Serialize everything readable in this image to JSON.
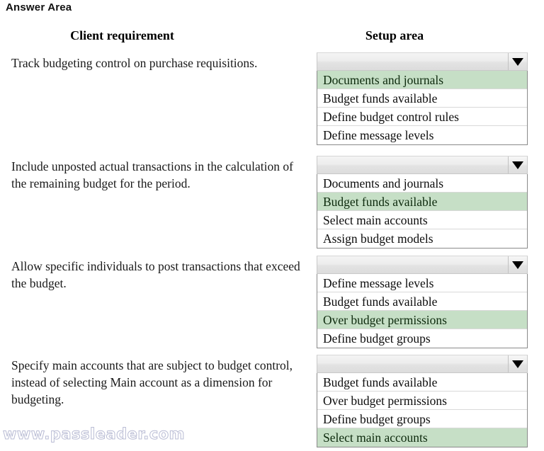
{
  "page": {
    "title": "Answer Area",
    "watermark": "www.passleader.com",
    "selected_highlight_color": "#c6dfc6"
  },
  "table": {
    "headers": {
      "client_requirement": "Client requirement",
      "setup_area": "Setup area"
    },
    "rows": [
      {
        "requirement": "Track budgeting control on purchase requisitions.",
        "dropdown": {
          "value": "",
          "arrow_icon": "chevron-down-icon",
          "options": [
            {
              "label": "Documents and journals",
              "selected": true
            },
            {
              "label": "Budget funds available",
              "selected": false
            },
            {
              "label": "Define budget control rules",
              "selected": false
            },
            {
              "label": "Define message levels",
              "selected": false
            }
          ]
        }
      },
      {
        "requirement": "Include unposted actual transactions in the calculation of the remaining budget for the period.",
        "dropdown": {
          "value": "",
          "arrow_icon": "chevron-down-icon",
          "options": [
            {
              "label": "Documents and journals",
              "selected": false
            },
            {
              "label": "Budget funds available",
              "selected": true
            },
            {
              "label": "Select main accounts",
              "selected": false
            },
            {
              "label": "Assign budget models",
              "selected": false
            }
          ]
        }
      },
      {
        "requirement": "Allow specific individuals to post transactions that exceed the budget.",
        "dropdown": {
          "value": "",
          "arrow_icon": "chevron-down-icon",
          "options": [
            {
              "label": "Define message levels",
              "selected": false
            },
            {
              "label": "Budget funds available",
              "selected": false
            },
            {
              "label": "Over budget permissions",
              "selected": true
            },
            {
              "label": "Define budget groups",
              "selected": false
            }
          ]
        }
      },
      {
        "requirement": "Specify main accounts that are subject to budget control, instead of selecting Main account as a dimension for budgeting.",
        "dropdown": {
          "value": "",
          "arrow_icon": "chevron-down-icon",
          "options": [
            {
              "label": "Budget funds available",
              "selected": false
            },
            {
              "label": "Over budget permissions",
              "selected": false
            },
            {
              "label": "Define budget groups",
              "selected": false
            },
            {
              "label": "Select main accounts",
              "selected": true
            }
          ]
        }
      }
    ]
  }
}
